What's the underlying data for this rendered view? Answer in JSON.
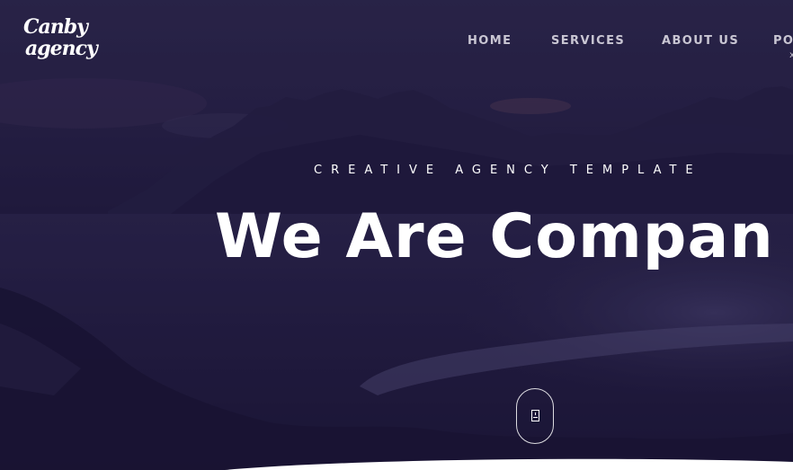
{
  "logo": {
    "line1": "Canby",
    "line2": "agency"
  },
  "nav": {
    "items": [
      {
        "label": "HOME"
      },
      {
        "label": "SERVICES"
      },
      {
        "label": "ABOUT US"
      },
      {
        "label": "PO"
      }
    ],
    "close_glyph": "x"
  },
  "hero": {
    "tagline": "CREATIVE AGENCY TEMPLATE",
    "headline": "We Are Compan"
  },
  "colors": {
    "overlay": "#241c44",
    "nav_text": "#c9c6d3",
    "text": "#ffffff"
  }
}
